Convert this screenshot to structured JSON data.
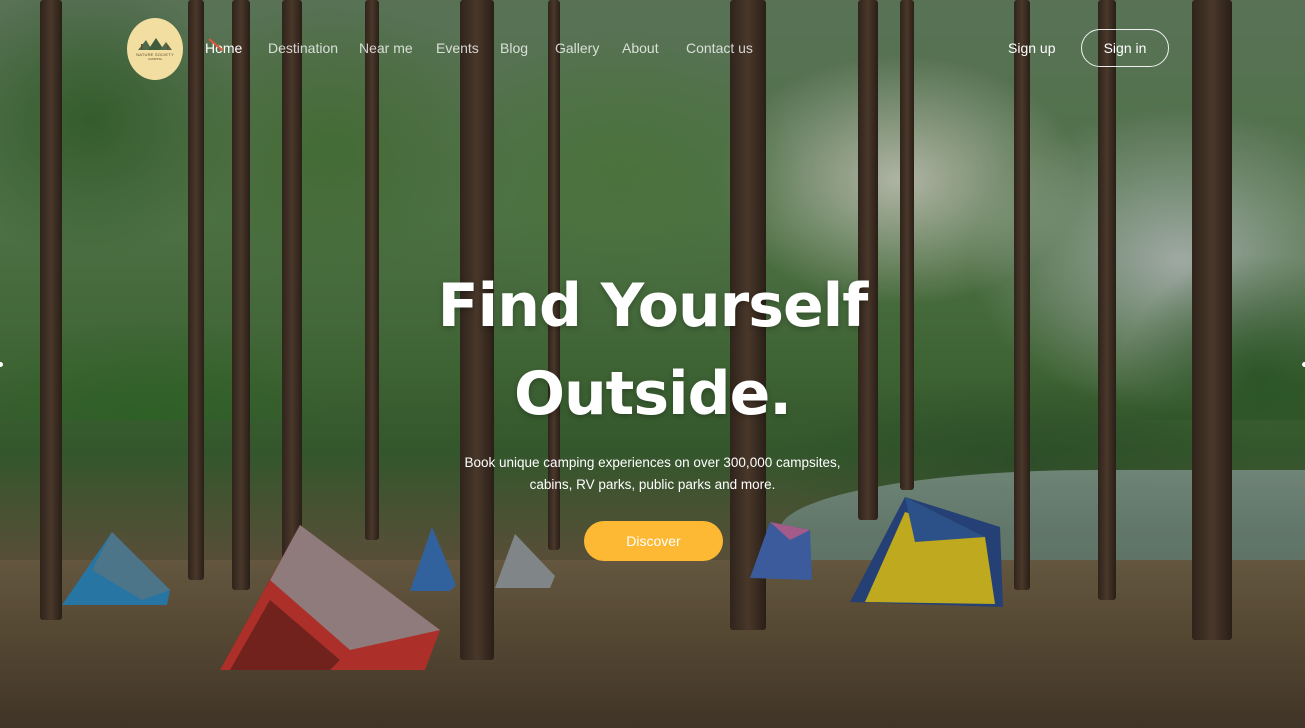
{
  "logo": {
    "name": "NATURE SOCIETY",
    "tagline": "CAMPING"
  },
  "nav": {
    "items": [
      {
        "label": "Home",
        "active": true
      },
      {
        "label": "Destination",
        "active": false
      },
      {
        "label": "Near me",
        "active": false
      },
      {
        "label": "Events",
        "active": false
      },
      {
        "label": "Blog",
        "active": false
      },
      {
        "label": "Gallery",
        "active": false
      },
      {
        "label": "About",
        "active": false
      },
      {
        "label": "Contact us",
        "active": false
      }
    ]
  },
  "auth": {
    "signup_label": "Sign up",
    "signin_label": "Sign in"
  },
  "hero": {
    "title_line1": "Find Yourself",
    "title_line2": "Outside.",
    "subtitle_line1": "Book unique camping experiences on over 300,000 campsites,",
    "subtitle_line2": "cabins, RV parks, public parks and more.",
    "cta_label": "Discover"
  },
  "colors": {
    "accent": "#fdb933",
    "logo_bg": "#f2dea0",
    "active_marker": "#e2573a"
  }
}
